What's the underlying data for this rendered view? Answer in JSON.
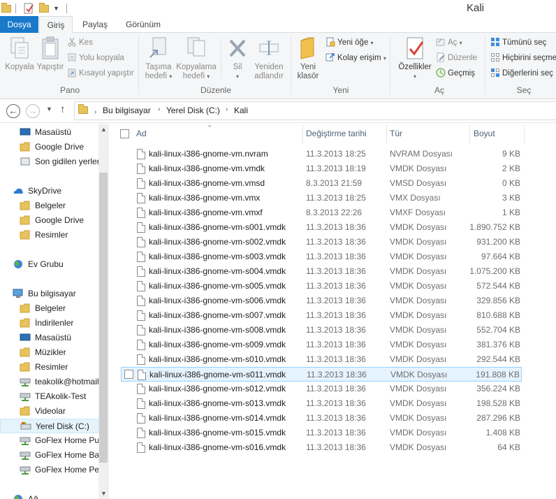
{
  "window": {
    "title": "Kali"
  },
  "tabs": [
    {
      "label": "Dosya"
    },
    {
      "label": "Giriş"
    },
    {
      "label": "Paylaş"
    },
    {
      "label": "Görünüm"
    }
  ],
  "ribbon": {
    "pano": {
      "label": "Pano",
      "kopyala": "Kopyala",
      "yapistir": "Yapıştır",
      "kes": "Kes",
      "yolu_kopyala": "Yolu kopyala",
      "kisayol_yapistir": "Kısayol yapıştır"
    },
    "duzenle": {
      "label": "Düzenle",
      "tasima_hedefi_1": "Taşıma",
      "tasima_hedefi_2": "hedefi",
      "kopyalama_hedefi_1": "Kopyalama",
      "kopyalama_hedefi_2": "hedefi",
      "sil": "Sil",
      "yeniden_adlandir_1": "Yeniden",
      "yeniden_adlandir_2": "adlandır"
    },
    "yeni": {
      "label": "Yeni",
      "yeni_klasor_1": "Yeni",
      "yeni_klasor_2": "klasör",
      "yeni_oge": "Yeni öğe",
      "kolay_erisim": "Kolay erişim"
    },
    "ac": {
      "label": "Aç",
      "ozellikler": "Özellikler",
      "ac": "Aç",
      "duzenle": "Düzenle",
      "gecmis": "Geçmiş"
    },
    "sec": {
      "label": "Seç",
      "tumunu_sec": "Tümünü seç",
      "hicbirini_secme": "Hiçbirini seçme",
      "digerlerini_sec": "Diğerlerini seç"
    }
  },
  "address": {
    "crumbs": [
      "Bu bilgisayar",
      "Yerel Disk (C:)",
      "Kali"
    ]
  },
  "nav": {
    "items": [
      {
        "label": "Masaüstü",
        "icon": "desktop-icon"
      },
      {
        "label": "Google Drive",
        "icon": "folder-icon"
      },
      {
        "label": "Son gidilen yerler",
        "icon": "recent-places-icon"
      },
      {
        "label": "SkyDrive",
        "icon": "skydrive-icon"
      },
      {
        "label": "Belgeler",
        "icon": "folder-icon"
      },
      {
        "label": "Google Drive",
        "icon": "folder-icon"
      },
      {
        "label": "Resimler",
        "icon": "folder-icon"
      },
      {
        "label": "Ev Grubu",
        "icon": "homegroup-icon"
      },
      {
        "label": "Bu bilgisayar",
        "icon": "computer-icon"
      },
      {
        "label": "Belgeler",
        "icon": "documents-icon"
      },
      {
        "label": "İndirilenler",
        "icon": "downloads-icon"
      },
      {
        "label": "Masaüstü",
        "icon": "desktop-icon"
      },
      {
        "label": "Müzikler",
        "icon": "music-icon"
      },
      {
        "label": "Resimler",
        "icon": "pictures-icon"
      },
      {
        "label": "teakolik@hotmail",
        "icon": "network-drive-icon"
      },
      {
        "label": "TEAkolik-Test",
        "icon": "network-drive-icon"
      },
      {
        "label": "Videolar",
        "icon": "videos-icon"
      },
      {
        "label": "Yerel Disk (C:)",
        "icon": "local-disk-icon"
      },
      {
        "label": "GoFlex Home Pu",
        "icon": "network-drive-icon"
      },
      {
        "label": "GoFlex Home Ba",
        "icon": "network-drive-icon"
      },
      {
        "label": "GoFlex Home Per",
        "icon": "network-drive-icon"
      },
      {
        "label": "Ağ",
        "icon": "network-icon"
      }
    ]
  },
  "columns": {
    "name": "Ad",
    "date": "Değiştirme tarihi",
    "type": "Tür",
    "size": "Boyut"
  },
  "files": [
    {
      "name": "kali-linux-i386-gnome-vm.nvram",
      "date": "11.3.2013 18:25",
      "type": "NVRAM Dosyası",
      "size": "9 KB"
    },
    {
      "name": "kali-linux-i386-gnome-vm.vmdk",
      "date": "11.3.2013 18:19",
      "type": "VMDK Dosyası",
      "size": "2 KB"
    },
    {
      "name": "kali-linux-i386-gnome-vm.vmsd",
      "date": "8.3.2013 21:59",
      "type": "VMSD Dosyası",
      "size": "0 KB"
    },
    {
      "name": "kali-linux-i386-gnome-vm.vmx",
      "date": "11.3.2013 18:25",
      "type": "VMX Dosyası",
      "size": "3 KB"
    },
    {
      "name": "kali-linux-i386-gnome-vm.vmxf",
      "date": "8.3.2013 22:26",
      "type": "VMXF Dosyası",
      "size": "1 KB"
    },
    {
      "name": "kali-linux-i386-gnome-vm-s001.vmdk",
      "date": "11.3.2013 18:36",
      "type": "VMDK Dosyası",
      "size": "1.890.752 KB"
    },
    {
      "name": "kali-linux-i386-gnome-vm-s002.vmdk",
      "date": "11.3.2013 18:36",
      "type": "VMDK Dosyası",
      "size": "931.200 KB"
    },
    {
      "name": "kali-linux-i386-gnome-vm-s003.vmdk",
      "date": "11.3.2013 18:36",
      "type": "VMDK Dosyası",
      "size": "97.664 KB"
    },
    {
      "name": "kali-linux-i386-gnome-vm-s004.vmdk",
      "date": "11.3.2013 18:36",
      "type": "VMDK Dosyası",
      "size": "1.075.200 KB"
    },
    {
      "name": "kali-linux-i386-gnome-vm-s005.vmdk",
      "date": "11.3.2013 18:36",
      "type": "VMDK Dosyası",
      "size": "572.544 KB"
    },
    {
      "name": "kali-linux-i386-gnome-vm-s006.vmdk",
      "date": "11.3.2013 18:36",
      "type": "VMDK Dosyası",
      "size": "329.856 KB"
    },
    {
      "name": "kali-linux-i386-gnome-vm-s007.vmdk",
      "date": "11.3.2013 18:36",
      "type": "VMDK Dosyası",
      "size": "810.688 KB"
    },
    {
      "name": "kali-linux-i386-gnome-vm-s008.vmdk",
      "date": "11.3.2013 18:36",
      "type": "VMDK Dosyası",
      "size": "552.704 KB"
    },
    {
      "name": "kali-linux-i386-gnome-vm-s009.vmdk",
      "date": "11.3.2013 18:36",
      "type": "VMDK Dosyası",
      "size": "381.376 KB"
    },
    {
      "name": "kali-linux-i386-gnome-vm-s010.vmdk",
      "date": "11.3.2013 18:36",
      "type": "VMDK Dosyası",
      "size": "292.544 KB"
    },
    {
      "name": "kali-linux-i386-gnome-vm-s011.vmdk",
      "date": "11.3.2013 18:36",
      "type": "VMDK Dosyası",
      "size": "191.808 KB"
    },
    {
      "name": "kali-linux-i386-gnome-vm-s012.vmdk",
      "date": "11.3.2013 18:36",
      "type": "VMDK Dosyası",
      "size": "356.224 KB"
    },
    {
      "name": "kali-linux-i386-gnome-vm-s013.vmdk",
      "date": "11.3.2013 18:36",
      "type": "VMDK Dosyası",
      "size": "198.528 KB"
    },
    {
      "name": "kali-linux-i386-gnome-vm-s014.vmdk",
      "date": "11.3.2013 18:36",
      "type": "VMDK Dosyası",
      "size": "287.296 KB"
    },
    {
      "name": "kali-linux-i386-gnome-vm-s015.vmdk",
      "date": "11.3.2013 18:36",
      "type": "VMDK Dosyası",
      "size": "1.408 KB"
    },
    {
      "name": "kali-linux-i386-gnome-vm-s016.vmdk",
      "date": "11.3.2013 18:36",
      "type": "VMDK Dosyası",
      "size": "64 KB"
    }
  ],
  "hover_row": 15,
  "selected_nav": 17,
  "colors": {
    "file_tab": "#1979ca",
    "hover_row_bg": "#e5f3ff",
    "hover_row_border": "#99d1ff"
  }
}
